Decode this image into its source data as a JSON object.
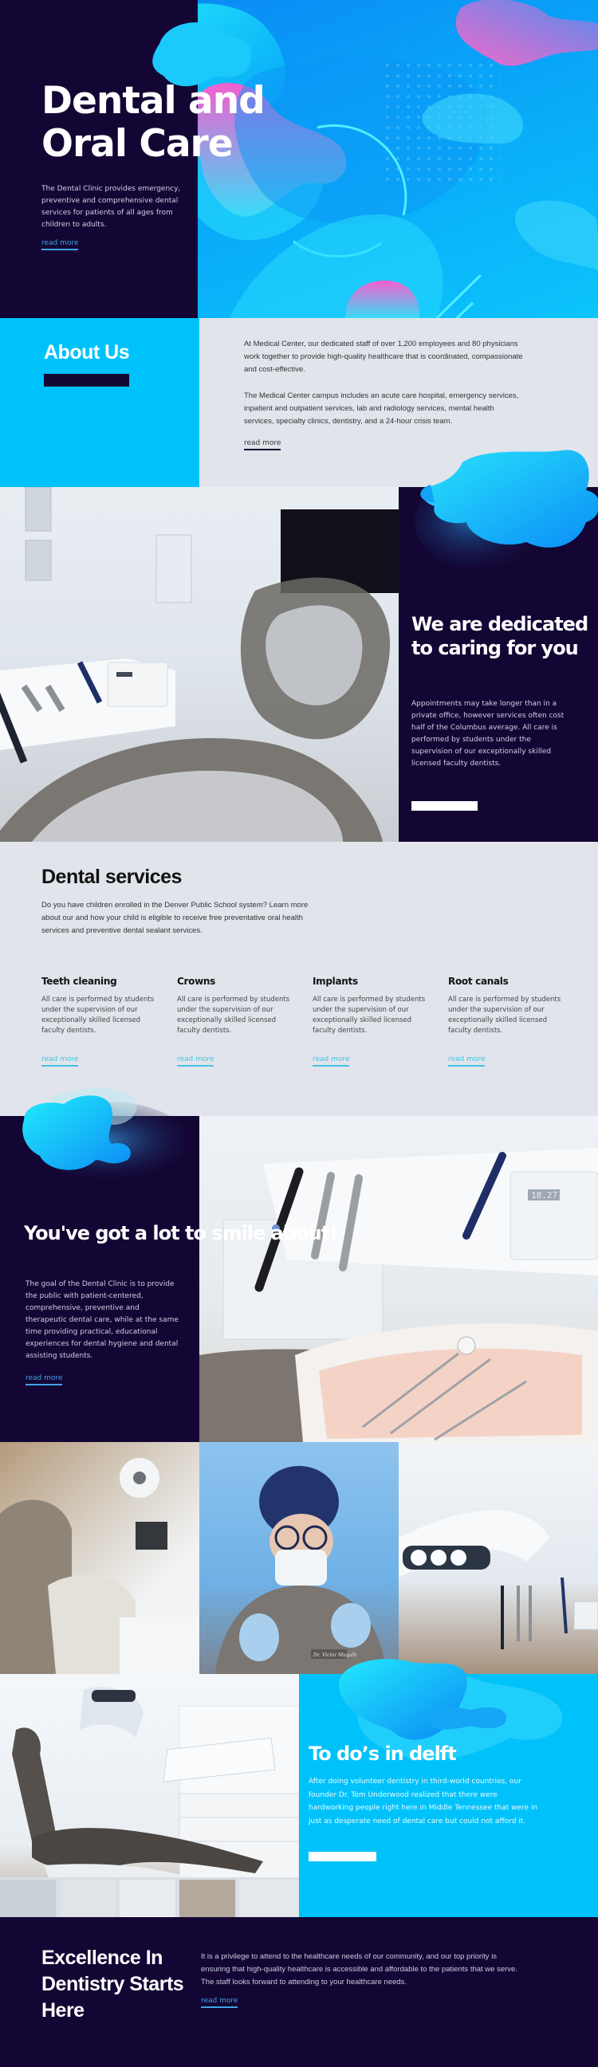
{
  "colors": {
    "navy": "#130634",
    "cyan": "#00c2fb",
    "light_grey": "#e1e4eb",
    "link_blue": "#3fa3e6",
    "pink_blob": "#f06acb"
  },
  "hero": {
    "title_line1": "Dental and",
    "title_line2": "Oral Care",
    "text": "The Dental Clinic provides emergency, preventive and comprehensive dental services for patients of all ages from children to adults.",
    "link": "read more"
  },
  "about": {
    "title": "About Us",
    "paragraph1": "At Medical Center, our dedicated staff of over 1,200 employees and 80 physicians work together to provide high-quality healthcare that is coordinated, compassionate and cost-effective.",
    "paragraph2": "The Medical Center campus includes an acute care hospital, emergency services, inpatient and outpatient services, lab and radiology services, mental health services, specialty clinics, dentistry, and a 24-hour crisis team.",
    "link": "read more"
  },
  "dedicated": {
    "title": "We are dedicated to caring for you",
    "text": "Appointments may take longer than in a private office, however services often cost half of the Columbus average. All care is performed by students under the supervision of our exceptionally skilled licensed faculty dentists.",
    "button_label": ""
  },
  "services": {
    "title": "Dental services",
    "intro": "Do you have children enrolled in the Denver Public School system? Learn more about our and how your child is eligible to receive free preventative oral health services and preventive dental sealant services.",
    "items": [
      {
        "title": "Teeth cleaning",
        "text": "All care is performed by students under the supervision of our exceptionally skilled licensed faculty dentists.",
        "link": "read more"
      },
      {
        "title": "Crowns",
        "text": "All care is performed by students under the supervision of our exceptionally skilled licensed faculty dentists.",
        "link": "read more"
      },
      {
        "title": "Implants",
        "text": "All care is performed by students under the supervision of our exceptionally skilled licensed faculty dentists.",
        "link": "read more"
      },
      {
        "title": "Root canals",
        "text": "All care is performed by students under the supervision of our exceptionally skilled licensed faculty dentists.",
        "link": "read more"
      }
    ]
  },
  "smile": {
    "title": "You've got a lot to smile about!",
    "text": "The goal of the Dental Clinic is to provide the public with patient-centered, comprehensive, preventive and therapeutic dental care, while at the same time providing practical, educational experiences for dental hygiene and dental assisting students.",
    "link": "read more",
    "photo_panel_display": "18.27"
  },
  "gallery": {
    "photos": [
      "dental-chair-overhead",
      "dentist-portrait",
      "dental-unit-light"
    ],
    "badge": "Dr. Victor Magalh"
  },
  "todo": {
    "title": "To do’s in delft",
    "text": "After doing volunteer dentistry in third-world countries, our founder Dr. Tom Underwood realized that there were hardworking people right here in Middle Tennessee that were in just as desperate need of dental care but could not afford it.",
    "button_label": ""
  },
  "footer": {
    "title": "Excellence In Dentistry Starts Here",
    "text": "It is a privilege to attend to the healthcare needs of our community, and our top priority is ensuring that high-quality healthcare is accessible and affordable to the patients that we serve. The staff looks forward to attending to your healthcare needs.",
    "link": "read more"
  }
}
